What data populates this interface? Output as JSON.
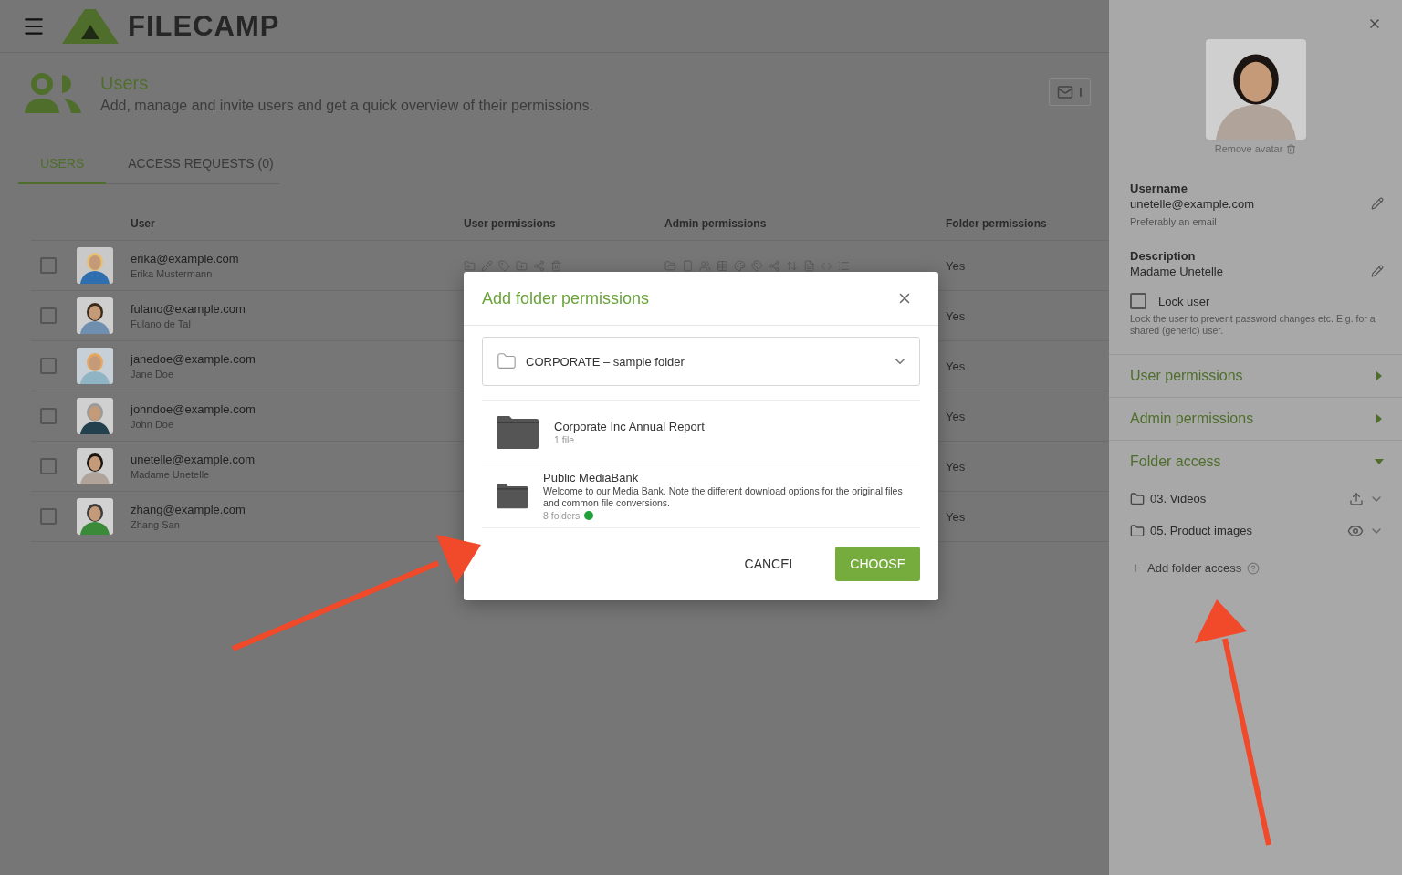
{
  "header": {
    "logo": "FILECAMP"
  },
  "page": {
    "title": "Users",
    "subtitle": "Add, manage and invite users and get a quick overview of their permissions.",
    "invite_button": "I"
  },
  "tabs": [
    {
      "label": "USERS",
      "selected": true
    },
    {
      "label": "ACCESS REQUESTS (0)",
      "selected": false
    }
  ],
  "table": {
    "columns": [
      "User",
      "User permissions",
      "Admin permissions",
      "Folder permissions"
    ],
    "rows": [
      {
        "email": "erika@example.com",
        "name": "Erika Mustermann",
        "checked": false,
        "permission_icons": true,
        "folder_permissions": "Yes"
      },
      {
        "email": "fulano@example.com",
        "name": "Fulano de Tal",
        "checked": false,
        "permission_icons": false,
        "folder_permissions": "Yes"
      },
      {
        "email": "janedoe@example.com",
        "name": "Jane Doe",
        "checked": false,
        "permission_icons": false,
        "folder_permissions": "Yes"
      },
      {
        "email": "johndoe@example.com",
        "name": "John Doe",
        "checked": false,
        "permission_icons": false,
        "folder_permissions": "Yes"
      },
      {
        "email": "unetelle@example.com",
        "name": "Madame Unetelle",
        "checked": false,
        "permission_icons": false,
        "folder_permissions": "Yes"
      },
      {
        "email": "zhang@example.com",
        "name": "Zhang San",
        "checked": false,
        "permission_icons": false,
        "folder_permissions": "Yes"
      }
    ]
  },
  "dialog": {
    "title": "Add folder permissions",
    "select": {
      "value": "CORPORATE – sample folder"
    },
    "folders": [
      {
        "name": "Corporate Inc Annual Report",
        "meta": "1 file"
      },
      {
        "name": "Public MediaBank",
        "description": "Welcome to our Media Bank. Note the different download options for the original files and common file conversions.",
        "meta": "8 folders",
        "color": "#22a03a"
      }
    ],
    "buttons": [
      {
        "label": "CANCEL",
        "kind": "text"
      },
      {
        "label": "CHOOSE",
        "kind": "primary"
      }
    ]
  },
  "user_panel": {
    "remove_avatar": "Remove avatar",
    "fields": [
      {
        "label": "Username",
        "value": "unetelle@example.com",
        "hint": "Preferably an email"
      },
      {
        "label": "Description",
        "value": "Madame Unetelle"
      }
    ],
    "lock": {
      "label": "Lock user",
      "checked": false,
      "hint": "Lock the user to prevent password changes etc. E.g. for a shared (generic) user."
    },
    "sections": [
      {
        "title": "User permissions",
        "expanded": false
      },
      {
        "title": "Admin permissions",
        "expanded": false
      },
      {
        "title": "Folder access",
        "expanded": true,
        "folders": [
          {
            "name": "03. Videos",
            "kind": "upload"
          },
          {
            "name": "05. Product images",
            "kind": "view"
          }
        ],
        "add_label": "Add folder access"
      }
    ]
  }
}
